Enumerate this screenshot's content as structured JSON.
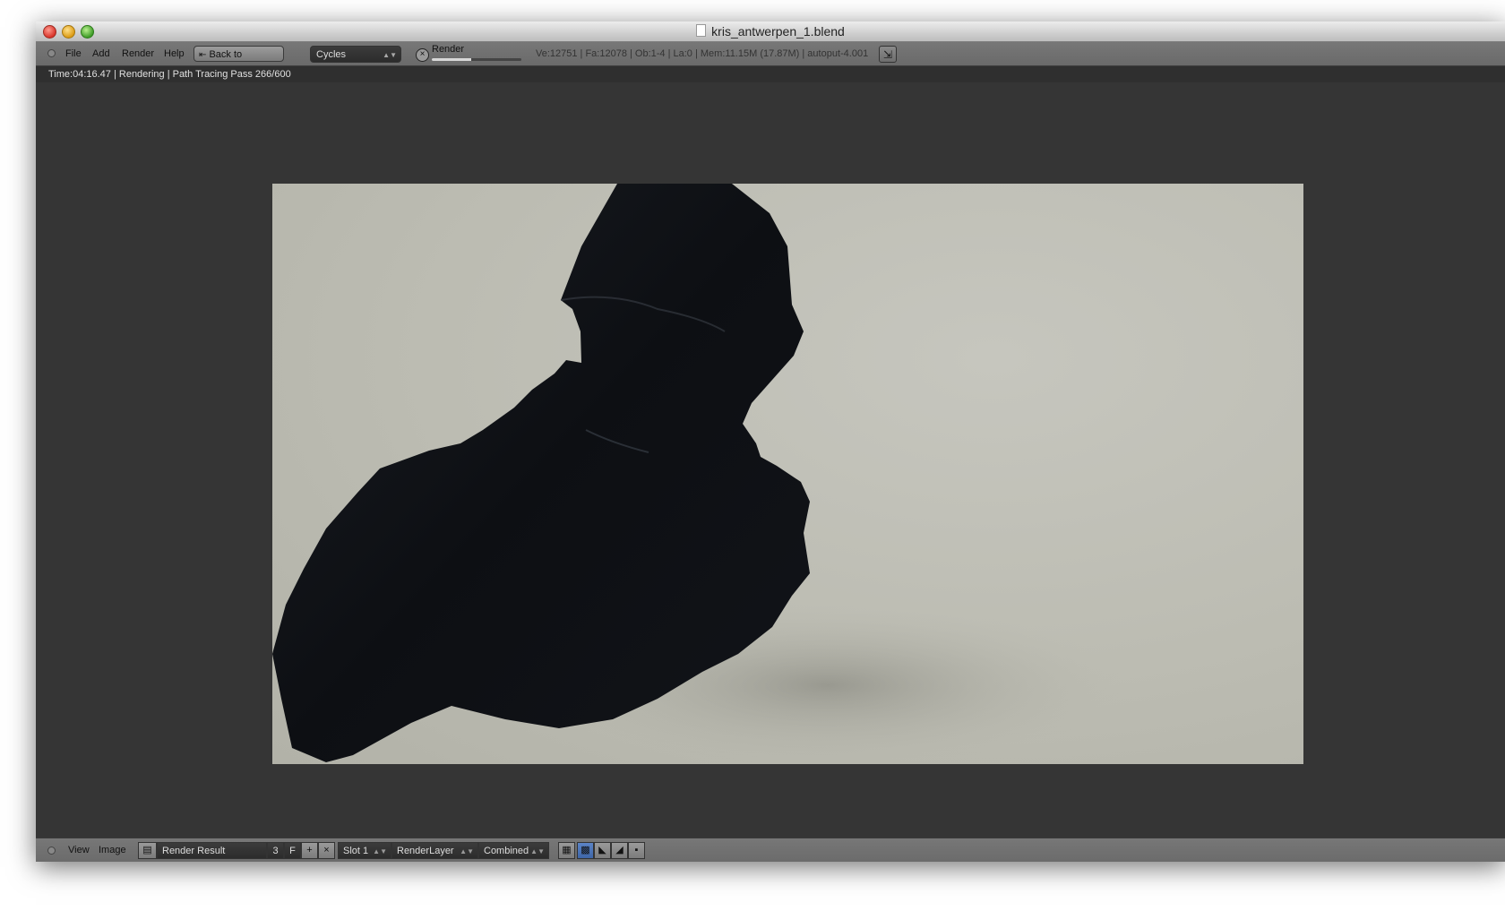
{
  "window": {
    "title": "kris_antwerpen_1.blend"
  },
  "header": {
    "menus": [
      "File",
      "Add",
      "Render",
      "Help"
    ],
    "back_button": "Back to Previous",
    "engine": "Cycles",
    "render_job_label": "Render",
    "render_progress": 0.44,
    "stats": "Ve:12751 | Fa:12078 | Ob:1-4 | La:0 | Mem:11.15M (17.87M) | autoput-4.001"
  },
  "status": {
    "text": "Time:04:16.47 | Rendering | Path Tracing Pass 266/600"
  },
  "footer": {
    "menus": [
      "View",
      "Image"
    ],
    "image_name": "Render Result",
    "users": "3",
    "fake_user": "F",
    "slot": "Slot 1",
    "layer": "RenderLayer",
    "pass": "Combined"
  },
  "colors": {
    "editor_bg": "#353535",
    "header_bg": "#6f6f6f",
    "render_bg": "#bcbcb2",
    "object": "#0f1115"
  },
  "icons": {
    "back": "back-arrow-icon",
    "cancel": "cancel-x-icon",
    "fullscreen": "fullscreen-icon",
    "new_image": "plus-icon",
    "unlink": "x-icon",
    "alpha": "checker-icon"
  }
}
